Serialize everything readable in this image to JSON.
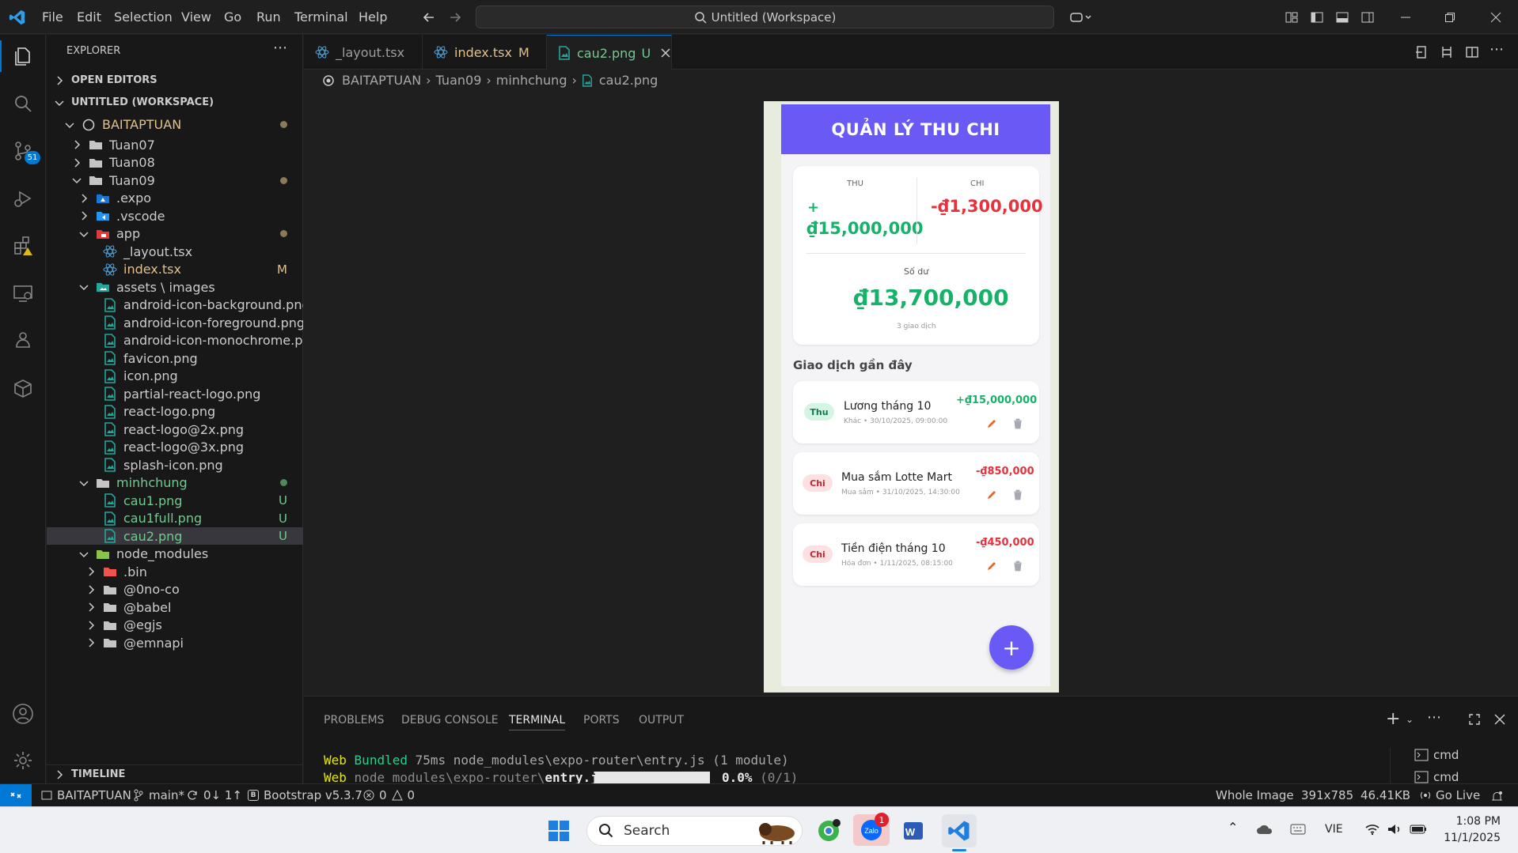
{
  "titlebar": {
    "menu": [
      "File",
      "Edit",
      "Selection",
      "View",
      "Go",
      "Run",
      "Terminal",
      "Help"
    ],
    "search_text": "Untitled (Workspace)"
  },
  "sidebar": {
    "title": "EXPLORER",
    "open_editors": "OPEN EDITORS",
    "workspace": "UNTITLED (WORKSPACE)",
    "root": "BAITAPTUAN",
    "timeline": "TIMELINE",
    "items": [
      {
        "label": "Tuan07",
        "badge": ""
      },
      {
        "label": "Tuan08",
        "badge": ""
      },
      {
        "label": "Tuan09",
        "badge": "dot"
      },
      {
        "label": ".expo",
        "badge": ""
      },
      {
        "label": ".vscode",
        "badge": ""
      },
      {
        "label": "app",
        "badge": "dot"
      },
      {
        "label": "_layout.tsx",
        "badge": ""
      },
      {
        "label": "index.tsx",
        "badge": "M"
      },
      {
        "label": "assets \\ images",
        "badge": ""
      },
      {
        "label": "android-icon-background.png",
        "badge": ""
      },
      {
        "label": "android-icon-foreground.png",
        "badge": ""
      },
      {
        "label": "android-icon-monochrome.p...",
        "badge": ""
      },
      {
        "label": "favicon.png",
        "badge": ""
      },
      {
        "label": "icon.png",
        "badge": ""
      },
      {
        "label": "partial-react-logo.png",
        "badge": ""
      },
      {
        "label": "react-logo.png",
        "badge": ""
      },
      {
        "label": "react-logo@2x.png",
        "badge": ""
      },
      {
        "label": "react-logo@3x.png",
        "badge": ""
      },
      {
        "label": "splash-icon.png",
        "badge": ""
      },
      {
        "label": "minhchung",
        "badge": "dot"
      },
      {
        "label": "cau1.png",
        "badge": "U"
      },
      {
        "label": "cau1full.png",
        "badge": "U"
      },
      {
        "label": "cau2.png",
        "badge": "U"
      },
      {
        "label": "node_modules",
        "badge": ""
      },
      {
        "label": ".bin",
        "badge": ""
      },
      {
        "label": "@0no-co",
        "badge": ""
      },
      {
        "label": "@babel",
        "badge": ""
      },
      {
        "label": "@egjs",
        "badge": ""
      },
      {
        "label": "@emnapi",
        "badge": ""
      }
    ]
  },
  "tabs": [
    {
      "label": "_layout.tsx",
      "status": ""
    },
    {
      "label": "index.tsx",
      "status": "M"
    },
    {
      "label": "cau2.png",
      "status": "U"
    }
  ],
  "breadcrumb": [
    "BAITAPTUAN",
    "Tuan09",
    "minhchung",
    "cau2.png"
  ],
  "app": {
    "header": "QUẢN LÝ THU CHI",
    "income_label": "THU",
    "income_sign": "+",
    "income_value": "₫15,000,000",
    "expense_label": "CHI",
    "expense_value": "-₫1,300,000",
    "balance_label": "Số dư",
    "balance_value": "₫13,700,000",
    "count": "3 giao dịch",
    "recent_title": "Giao dịch gần đây",
    "transactions": [
      {
        "type": "Thu",
        "title": "Lương tháng 10",
        "meta": "Khác • 30/10/2025, 09:00:00",
        "amount": "+₫15,000,000"
      },
      {
        "type": "Chi",
        "title": "Mua sắm Lotte Mart",
        "meta": "Mua sắm • 31/10/2025, 14:30:00",
        "amount": "-₫850,000"
      },
      {
        "type": "Chi",
        "title": "Tiền điện tháng 10",
        "meta": "Hóa đơn • 1/11/2025, 08:15:00",
        "amount": "-₫450,000"
      }
    ],
    "fab": "+"
  },
  "panel": {
    "tabs": [
      "PROBLEMS",
      "DEBUG CONSOLE",
      "TERMINAL",
      "PORTS",
      "OUTPUT"
    ],
    "active": "TERMINAL",
    "line1_prefix": "Web",
    "line1_text": "Bundled",
    "line1_rest": "75ms node_modules\\expo-router\\entry.js (1 module)",
    "line2_prefix": "Web",
    "line2_path": "node_modules\\expo-router\\",
    "line2_file": "entry.js",
    "line2_pct": "0.0%",
    "line2_count": "(0/1)",
    "terminals": [
      "cmd",
      "cmd"
    ]
  },
  "status": {
    "remote": "",
    "root": "BAITAPTUAN",
    "branch": "main*",
    "sync": "0↓ 1↑",
    "bootstrap": "Bootstrap v5.3.7",
    "errors": "0",
    "warnings": "0",
    "whole_image": "Whole Image",
    "dims": "391x785",
    "size": "46.41KB",
    "golive": "Go Live"
  },
  "taskbar": {
    "search": "Search",
    "notif": "1",
    "lang": "VIE",
    "time": "1:08 PM",
    "date": "11/1/2025"
  },
  "colors": {
    "accent": "#6a5af5",
    "income": "#17b26a",
    "expense": "#e5323d",
    "modified": "#e2c08d",
    "untracked": "#73c991"
  }
}
